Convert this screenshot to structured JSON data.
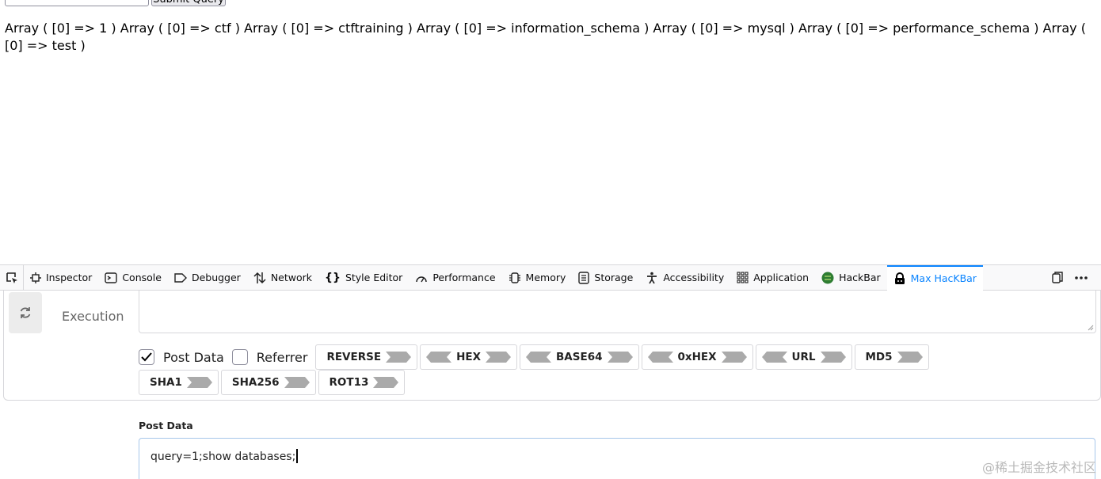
{
  "page": {
    "submit_label": "Submit Query",
    "result": "Array ( [0] => 1 ) Array ( [0] => ctf ) Array ( [0] => ctftraining ) Array ( [0] => information_schema ) Array ( [0] => mysql ) Array ( [0] => performance_schema ) Array ( [0] => test )"
  },
  "devtools": {
    "tabs": [
      {
        "label": "Inspector",
        "icon": "inspector-icon"
      },
      {
        "label": "Console",
        "icon": "console-icon"
      },
      {
        "label": "Debugger",
        "icon": "debugger-icon"
      },
      {
        "label": "Network",
        "icon": "network-icon"
      },
      {
        "label": "Style Editor",
        "icon": "style-editor-icon"
      },
      {
        "label": "Performance",
        "icon": "performance-icon"
      },
      {
        "label": "Memory",
        "icon": "memory-icon"
      },
      {
        "label": "Storage",
        "icon": "storage-icon"
      },
      {
        "label": "Accessibility",
        "icon": "accessibility-icon"
      },
      {
        "label": "Application",
        "icon": "application-icon"
      },
      {
        "label": "HackBar",
        "icon": "hackbar-icon"
      },
      {
        "label": "Max HacKBar",
        "icon": "max-hackbar-icon",
        "active": true
      }
    ],
    "accent_color": "#0a84ff"
  },
  "hackbar": {
    "execution_label": "Execution",
    "post_data_checkbox": {
      "label": "Post Data",
      "checked": true
    },
    "referrer_checkbox": {
      "label": "Referrer",
      "checked": false
    },
    "encoders_row1": [
      "REVERSE",
      "HEX",
      "BASE64",
      "0xHEX",
      "URL",
      "MD5"
    ],
    "encoders_row2": [
      "SHA1",
      "SHA256",
      "ROT13"
    ],
    "post_data_title": "Post Data",
    "post_data_value": "query=1;show databases;"
  },
  "watermark": "@稀土掘金技术社区"
}
